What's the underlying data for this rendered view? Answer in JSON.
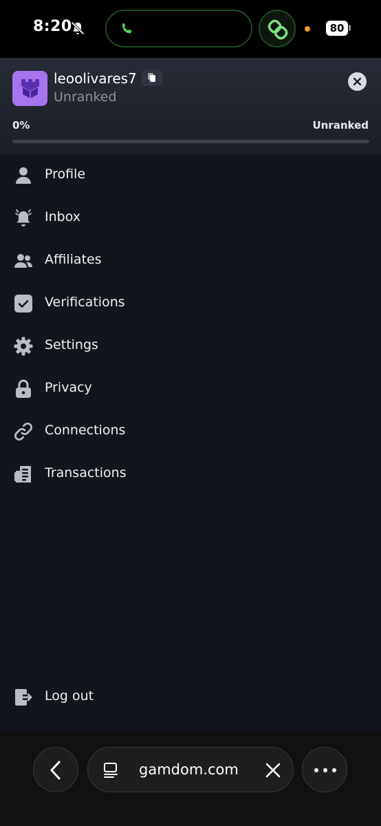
{
  "status_bar": {
    "time": "8:20",
    "battery": "80"
  },
  "profile": {
    "username": "leoolivares7",
    "rank": "Unranked",
    "progress_label": "0%",
    "progress_rank": "Unranked",
    "progress_value": 0
  },
  "menu": {
    "items": [
      {
        "label": "Profile",
        "icon": "user-icon"
      },
      {
        "label": "Inbox",
        "icon": "bell-icon"
      },
      {
        "label": "Affiliates",
        "icon": "users-icon"
      },
      {
        "label": "Verifications",
        "icon": "checkbox-icon"
      },
      {
        "label": "Settings",
        "icon": "gear-icon"
      },
      {
        "label": "Privacy",
        "icon": "lock-icon"
      },
      {
        "label": "Connections",
        "icon": "link-icon"
      },
      {
        "label": "Transactions",
        "icon": "receipt-icon"
      }
    ],
    "logout": {
      "label": "Log out",
      "icon": "logout-icon"
    }
  },
  "browser": {
    "url": "gamdom.com"
  },
  "colors": {
    "accent": "#a574ee",
    "background": "#12151b",
    "progress": "#7c4dff"
  }
}
